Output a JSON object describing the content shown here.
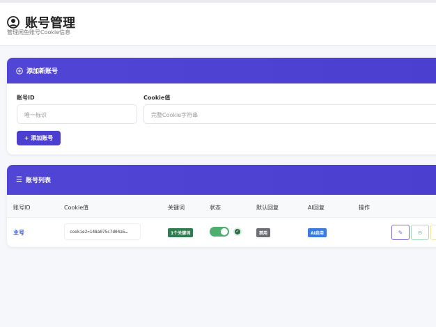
{
  "header": {
    "title": "账号管理",
    "subtitle": "管理闲鱼账号Cookie信息",
    "icon": "user-circle-icon"
  },
  "add_card": {
    "title": "添加新账号",
    "icon": "plus-circle-icon",
    "account_id_label": "账号ID",
    "account_id_placeholder": "唯一标识",
    "cookie_label": "Cookie值",
    "cookie_placeholder": "完整Cookie字符串",
    "add_button": "+ 添加账号"
  },
  "list_card": {
    "title": "账号列表",
    "icon": "list-icon",
    "columns": [
      "账号ID",
      "Cookie值",
      "关键词",
      "状态",
      "默认回复",
      "AI回复",
      "操作"
    ],
    "rows": [
      {
        "account_id": "主号",
        "cookie": "cookie2=148a075c7d04a5…",
        "keywords": "1个关键词",
        "status_enabled": true,
        "default_reply": "禁用",
        "ai_reply": "AI启用"
      }
    ]
  },
  "colors": {
    "accent": "#4b3fcf",
    "keyword_badge": "#2e7d4f",
    "toggle_on": "#4caf70",
    "disabled_badge": "#6b6f75",
    "ai_badge": "#3b7be0"
  }
}
